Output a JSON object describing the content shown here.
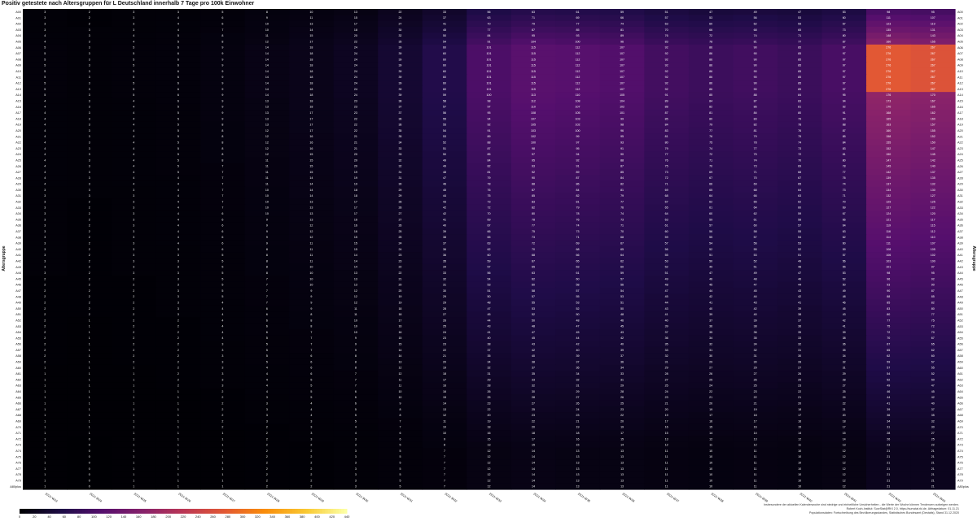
{
  "chart_data": {
    "type": "heatmap",
    "title": "Positiv getestete nach Altersgruppen für L Deutschland innerhalb 7 Tage pro 100k Einwohner",
    "ylabel": "Altersgruppe",
    "ylabel_right": "Altersgruppe",
    "colormap": "inferno",
    "colors": {
      "low": "#000004",
      "mid": "#bc3754",
      "high": "#fcffa4",
      "text": "#ffffff"
    },
    "color_range": [
      0,
      440
    ],
    "colorbar_ticks": [
      "0",
      "20",
      "40",
      "60",
      "80",
      "100",
      "120",
      "140",
      "160",
      "180",
      "200",
      "220",
      "240",
      "260",
      "280",
      "300",
      "320",
      "340",
      "360",
      "380",
      "400",
      "420",
      "440"
    ],
    "x": [
      "2021-W23",
      "2021-W24",
      "2021-W25",
      "2021-W26",
      "2021-W27",
      "2021-W28",
      "2021-W29",
      "2021-W30",
      "2021-W31",
      "2021-W32",
      "2021-W33",
      "2021-W34",
      "2021-W35",
      "2021-W36",
      "2021-W37",
      "2021-W38",
      "2021-W39",
      "2021-W40",
      "2021-W41",
      "2021-W42",
      "2021-W43"
    ],
    "y": [
      "A00",
      "A01",
      "A02",
      "A03",
      "A04",
      "A05",
      "A06",
      "A07",
      "A08",
      "A09",
      "A10",
      "A11",
      "A12",
      "A13",
      "A14",
      "A15",
      "A16",
      "A17",
      "A18",
      "A19",
      "A20",
      "A21",
      "A22",
      "A23",
      "A24",
      "A25",
      "A26",
      "A27",
      "A28",
      "A29",
      "A30",
      "A31",
      "A32",
      "A33",
      "A34",
      "A35",
      "A36",
      "A37",
      "A38",
      "A39",
      "A40",
      "A41",
      "A42",
      "A43",
      "A44",
      "A45",
      "A46",
      "A47",
      "A48",
      "A49",
      "A50",
      "A51",
      "A52",
      "A53",
      "A54",
      "A55",
      "A56",
      "A57",
      "A58",
      "A59",
      "A60",
      "A61",
      "A62",
      "A63",
      "A64",
      "A65",
      "A66",
      "A67",
      "A68",
      "A69",
      "A70",
      "A71",
      "A72",
      "A73",
      "A74",
      "A75",
      "A76",
      "A77",
      "A78",
      "A79",
      "A80plus"
    ],
    "profile": {
      "peak_rows_start": 6,
      "peak_rows_end": 13,
      "week_scale": [
        4,
        3,
        4,
        5,
        8,
        12,
        16,
        21,
        34,
        52,
        88,
        100,
        97,
        93,
        80,
        75,
        78,
        74,
        84,
        155,
        150
      ]
    }
  },
  "notes": [
    "Insbesondere der aktuellen Kalenderwoche sind niedrige und einheitliche Unsicherheiten - die Werte der Woche können Tendenzen aufzeigen werden.",
    "Robert Koch-Institut: SurvStat@RKI 2.0, https://survstat.rki.de, Abfragedatum: 01.11.21",
    "Populationsdaten: Fortschreibung des Bevölkerungsstandes, Statistisches Bundesamt (Destatis), Stand 31.12.2020"
  ]
}
